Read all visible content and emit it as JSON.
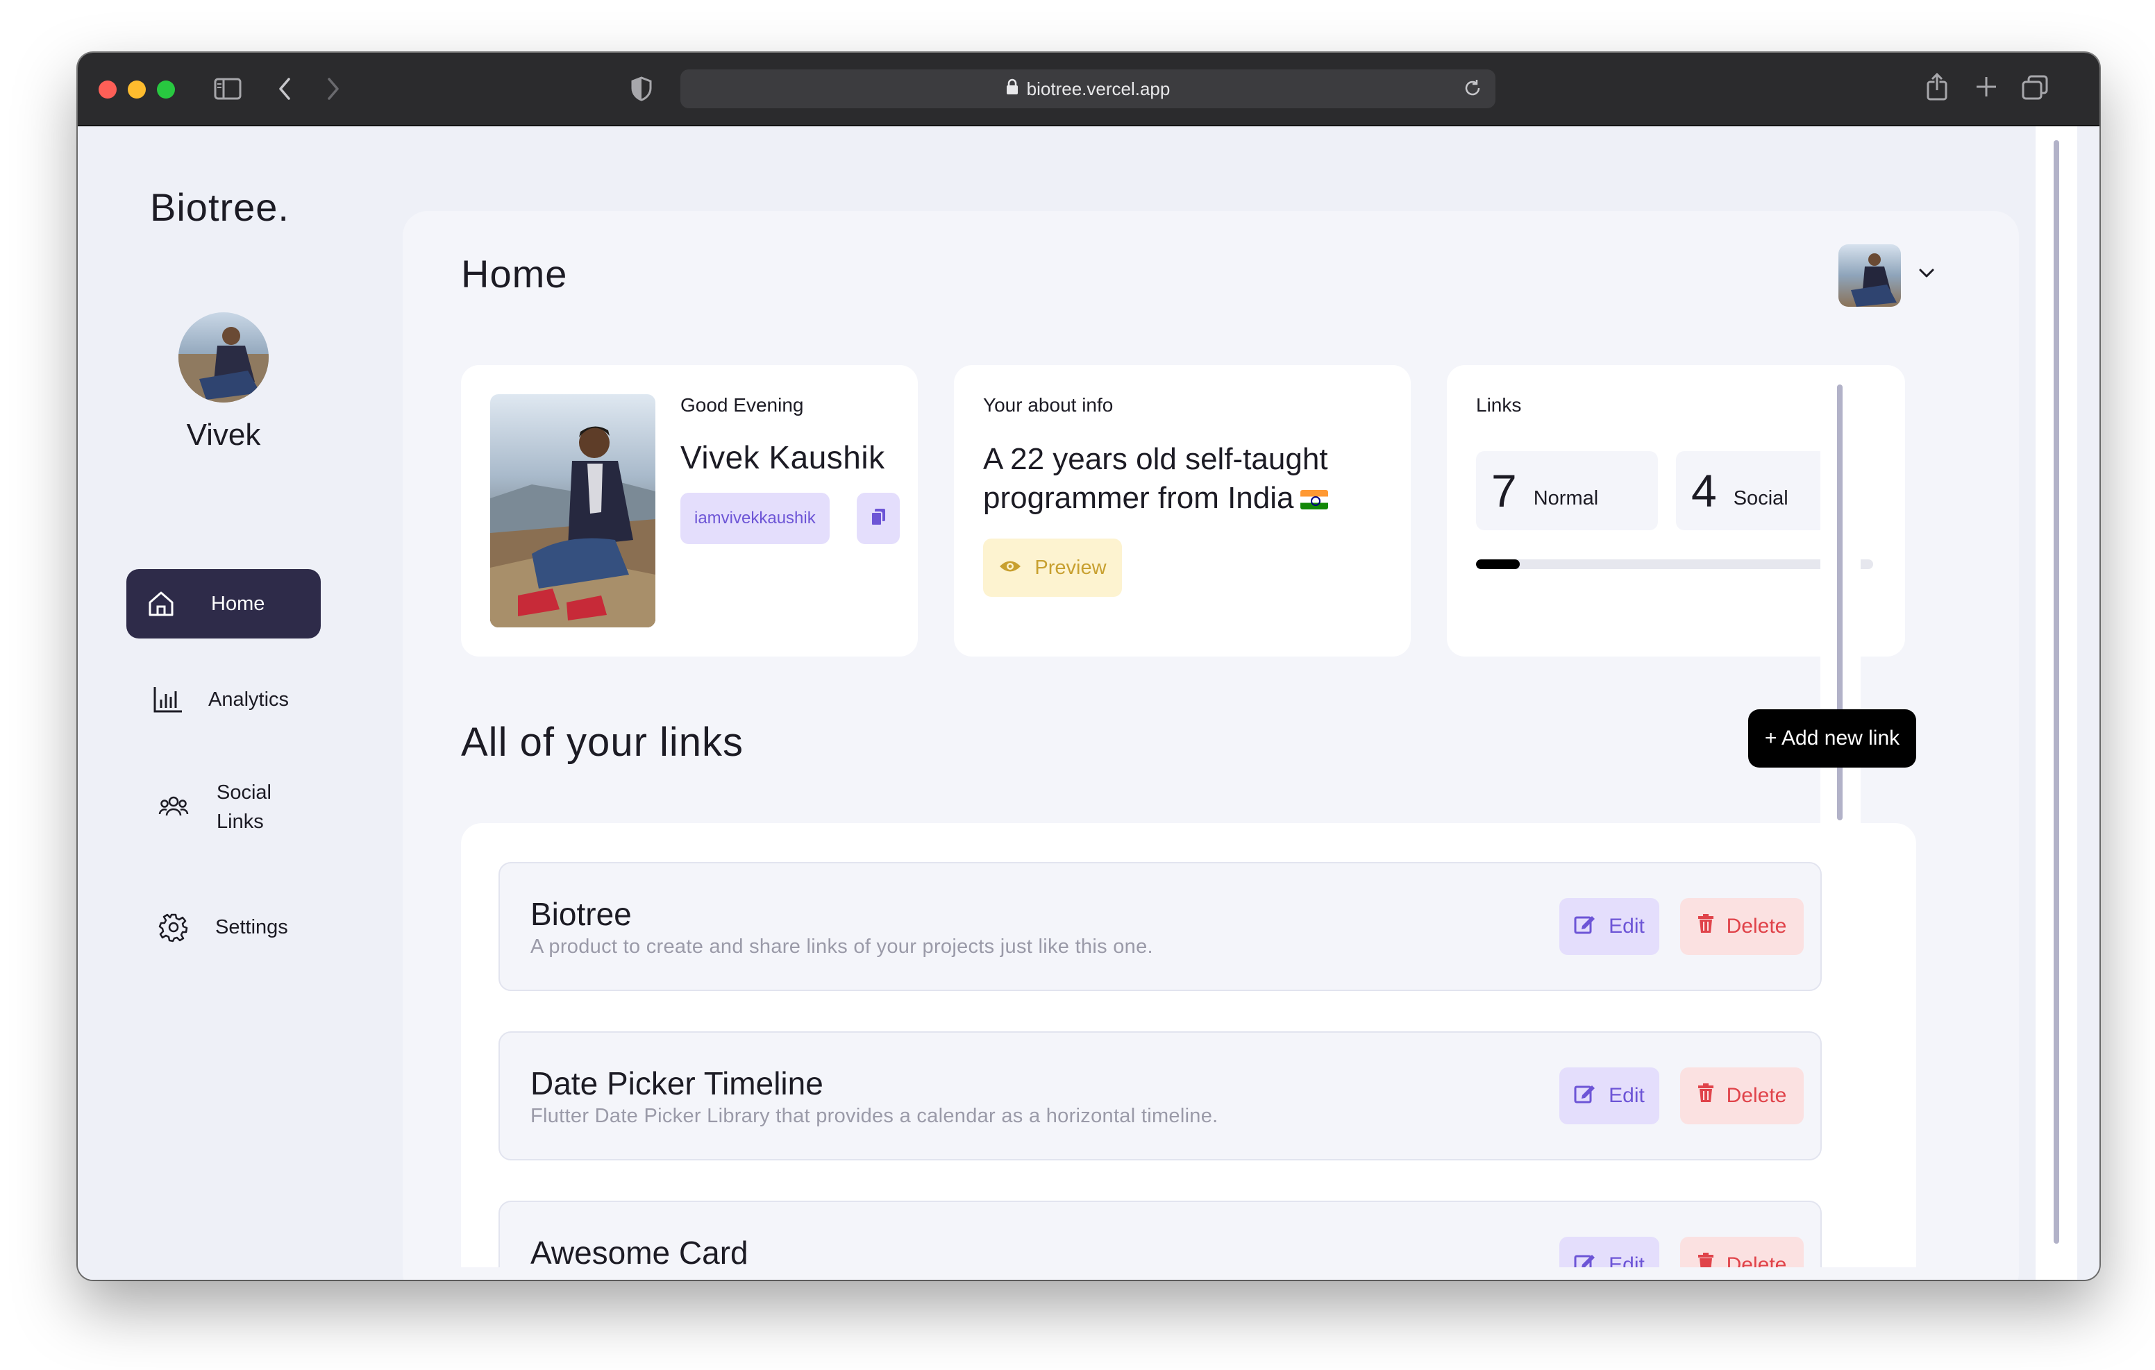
{
  "browser": {
    "url": "biotree.vercel.app"
  },
  "sidebar": {
    "brand": "Biotree.",
    "user_name": "Vivek",
    "items": [
      {
        "label": "Home",
        "icon": "home-icon",
        "active": true
      },
      {
        "label": "Analytics",
        "icon": "bar-chart-icon",
        "active": false
      },
      {
        "label": "Social\nLinks",
        "icon": "users-icon",
        "active": false
      },
      {
        "label": "Settings",
        "icon": "gear-icon",
        "active": false
      }
    ]
  },
  "header": {
    "title": "Home"
  },
  "profile_card": {
    "greeting": "Good Evening",
    "full_name": "Vivek Kaushik",
    "handle": "iamvivekkaushik"
  },
  "about_card": {
    "heading": "Your about info",
    "text": "A 22 years old self-taught programmer from India",
    "preview_label": "Preview"
  },
  "links_card": {
    "heading": "Links",
    "normal_count": "7",
    "normal_label": "Normal",
    "social_count": "4",
    "social_label": "Social",
    "progress": 0.11
  },
  "links_section": {
    "title": "All of your links",
    "add_button": "+ Add new link",
    "edit_label": "Edit",
    "delete_label": "Delete",
    "items": [
      {
        "title": "Biotree",
        "description": "A product to create and share links of your projects just like this one."
      },
      {
        "title": "Date Picker Timeline",
        "description": "Flutter Date Picker Library that provides a calendar as a horizontal timeline."
      },
      {
        "title": "Awesome Card",
        "description": ""
      }
    ]
  },
  "colors": {
    "accent_dark": "#2e2b49",
    "edit_bg": "#e4defc",
    "edit_fg": "#6d55d6",
    "delete_bg": "#fbe1e1",
    "delete_fg": "#e0434a",
    "preview_bg": "#fdf3d0",
    "preview_fg": "#c8a030"
  }
}
